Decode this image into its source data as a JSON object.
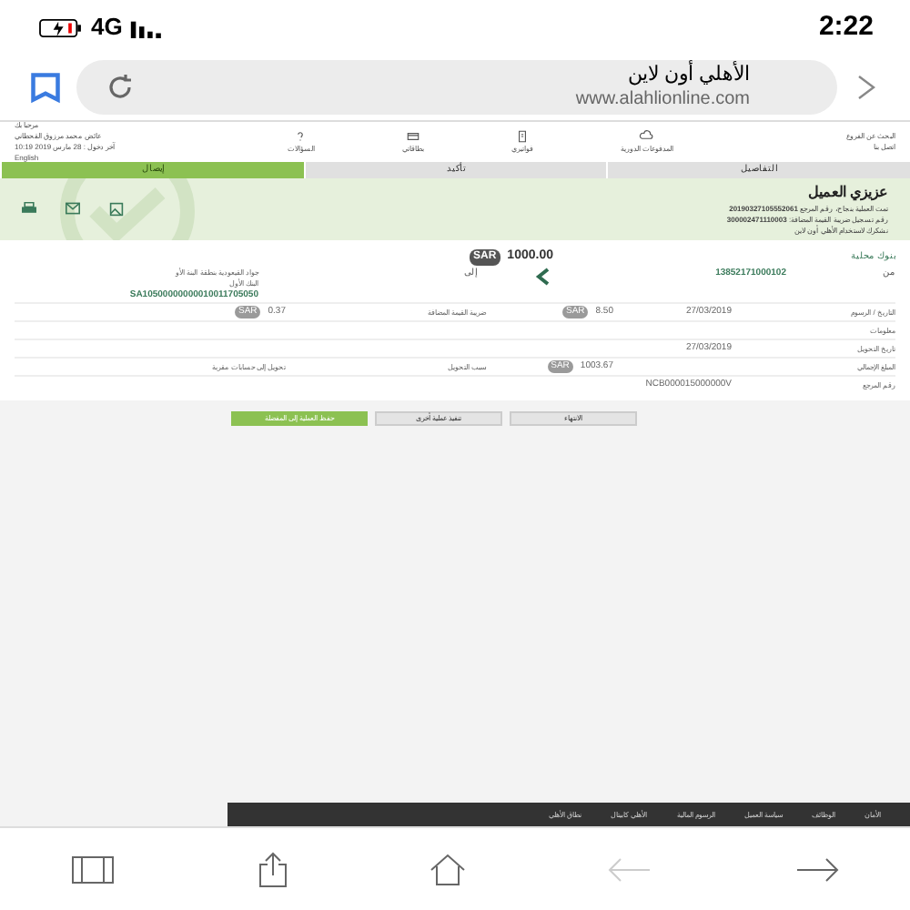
{
  "status_bar": {
    "network": "4G",
    "time": "2:22"
  },
  "browser": {
    "title": "الأهلي أون لاين",
    "url": "www.alahlionline.com"
  },
  "header": {
    "links": [
      "البحث عن الفروع",
      "اتصل بنا"
    ],
    "nav": [
      {
        "label": "المدفوعات الدورية",
        "kind": "cloud"
      },
      {
        "label": "فواتيري",
        "kind": "bill"
      },
      {
        "label": "بطاقاتي",
        "kind": "card"
      },
      {
        "label": "السؤالات",
        "kind": "question"
      }
    ],
    "welcome": "مرحبا بك",
    "user": "عائض محمد مرزوق القحطاني",
    "last_login": "آخر دخول : 28 مارس 2019 10:19",
    "language": "English"
  },
  "steps": [
    {
      "label": "التفاصيل",
      "selected": false
    },
    {
      "label": "تأكيد",
      "selected": false
    },
    {
      "label": "إيصال",
      "selected": true
    }
  ],
  "receipt": {
    "title": "عزيزي العميل",
    "lines": [
      "تمت العملية بنجاح، رقم المرجع **20190327105552061**",
      "رقم تسجيل ضريبة القيمة المضافة: **300002471110003**",
      "نشكرك لاستخدام الأهلي أون لاين"
    ]
  },
  "transfer": {
    "type": "بنوك محلية",
    "currency": "SAR",
    "amount": "1000.00",
    "from_label": "من",
    "from_account": "13852171000102",
    "to_label": "إلى",
    "beneficiary": [
      "جواد القيعودية بنطقة البنة الأو",
      "البنك الأول"
    ],
    "iban": "SA10500000000010011705050"
  },
  "details": [
    {
      "label": "التاريخ / الرسوم",
      "value": "27/03/2019",
      "currency": "SAR",
      "money": "8.50",
      "label2": "ضريبة القيمة المضافة",
      "currency2": "SAR",
      "value2": "0.37"
    },
    {
      "label": "معلومات"
    },
    {
      "label": "تاريخ التحويل",
      "value": "27/03/2019"
    },
    {
      "label": "المبلغ الإجمالي",
      "currency": "SAR",
      "money": "1003.67",
      "label2": "سبب التحويل",
      "value2": "تحويل إلى حسابات مقربة"
    },
    {
      "label": "رقم المرجع",
      "value": "NCB000015000000V"
    }
  ],
  "buttons": [
    {
      "label": "الانتهاء",
      "kind": "plain"
    },
    {
      "label": "تنفيذ عملية أخرى",
      "kind": "plain"
    },
    {
      "label": "حفظ العملية إلى المفضلة",
      "kind": "primary"
    }
  ],
  "footer": [
    "الأمان",
    "الوظائف",
    "سياسة العميل",
    "الرسوم المالية",
    "الأهلي كابيتال",
    "نطاق الأهلي"
  ]
}
